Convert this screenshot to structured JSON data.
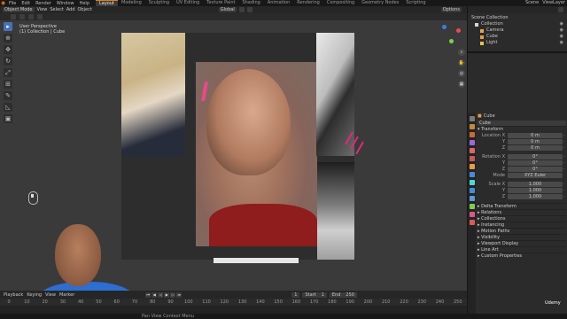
{
  "topbar": {
    "menu": [
      "File",
      "Edit",
      "Render",
      "Window",
      "Help"
    ],
    "workspaces": [
      {
        "label": "Layout",
        "active": true
      },
      {
        "label": "Modeling",
        "active": false
      },
      {
        "label": "Sculpting",
        "active": false
      },
      {
        "label": "UV Editing",
        "active": false
      },
      {
        "label": "Texture Paint",
        "active": false
      },
      {
        "label": "Shading",
        "active": false
      },
      {
        "label": "Animation",
        "active": false
      },
      {
        "label": "Rendering",
        "active": false
      },
      {
        "label": "Compositing",
        "active": false
      },
      {
        "label": "Geometry Nodes",
        "active": false
      },
      {
        "label": "Scripting",
        "active": false
      }
    ],
    "scene": "Scene",
    "view_layer": "ViewLayer"
  },
  "viewport_header": {
    "mode": "Object Mode",
    "menus": [
      "View",
      "Select",
      "Add",
      "Object"
    ],
    "orientation": "Global",
    "options": "Options"
  },
  "viewport": {
    "perspective": "User Perspective",
    "collection_info": "(1) Collection | Cube"
  },
  "outliner": {
    "title": "Scene Collection",
    "items": [
      {
        "label": "Collection",
        "color": "#d6d6d6"
      },
      {
        "label": "Camera",
        "color": "#e0a55a"
      },
      {
        "label": "Cube",
        "color": "#e89a45"
      },
      {
        "label": "Light",
        "color": "#e0c45a"
      }
    ]
  },
  "properties": {
    "object_name": "Cube",
    "data_name": "Cube",
    "transform_label": "Transform",
    "location": {
      "label": "Location X",
      "y": "Y",
      "z": "Z",
      "values": [
        "0 m",
        "0 m",
        "0 m"
      ]
    },
    "rotation": {
      "label": "Rotation X",
      "y": "Y",
      "z": "Z",
      "values": [
        "0°",
        "0°",
        "0°"
      ]
    },
    "mode": {
      "label": "Mode",
      "value": "XYZ Euler"
    },
    "scale": {
      "label": "Scale X",
      "y": "Y",
      "z": "Z",
      "values": [
        "1.000",
        "1.000",
        "1.000"
      ]
    },
    "sections": [
      "Delta Transform",
      "Relations",
      "Collections",
      "Instancing",
      "Motion Paths",
      "Visibility",
      "Viewport Display",
      "Line Art",
      "Custom Properties"
    ]
  },
  "timeline": {
    "playback": "Playback",
    "keying": "Keying",
    "view": "View",
    "marker": "Marker",
    "current_frame": "1",
    "start_label": "Start",
    "start": "1",
    "end_label": "End",
    "end": "250",
    "ruler": [
      "0",
      "10",
      "20",
      "30",
      "40",
      "50",
      "60",
      "70",
      "80",
      "90",
      "100",
      "110",
      "120",
      "130",
      "140",
      "150",
      "160",
      "170",
      "180",
      "190",
      "200",
      "210",
      "220",
      "230",
      "240",
      "250"
    ]
  },
  "status": {
    "text": "Pan View    Context Menu"
  },
  "watermark": {
    "brand": "Udemy"
  }
}
